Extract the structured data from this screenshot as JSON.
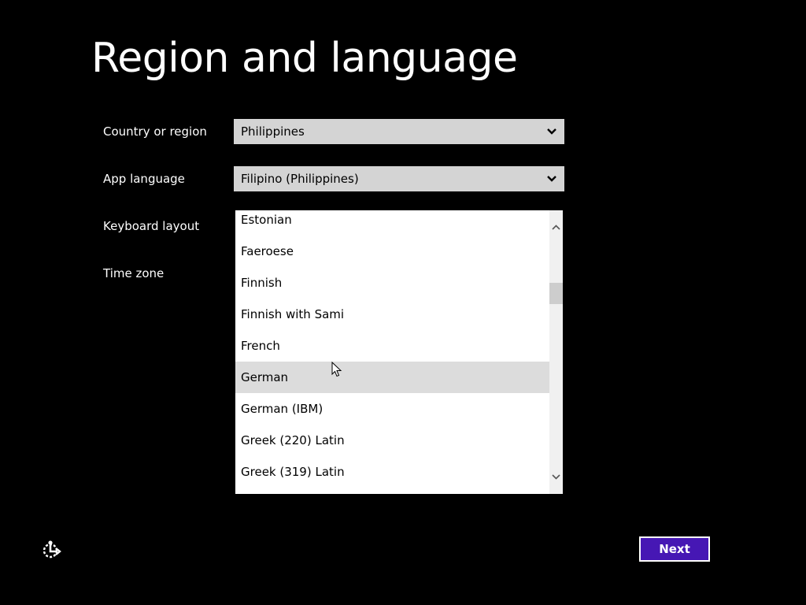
{
  "title": "Region and language",
  "labels": {
    "country": "Country or region",
    "app_language": "App language",
    "keyboard": "Keyboard layout",
    "time_zone": "Time zone"
  },
  "country": {
    "value": "Philippines"
  },
  "app_language": {
    "value": "Filipino (Philippines)"
  },
  "keyboard_list": {
    "items": [
      "Estonian",
      "Faeroese",
      "Finnish",
      "Finnish with Sami",
      "French",
      "German",
      "German (IBM)",
      "Greek (220) Latin",
      "Greek (319) Latin"
    ],
    "hovered_item": "German"
  },
  "buttons": {
    "next": "Next"
  },
  "icons": {
    "ease_of_access": "ease-of-access-icon",
    "dropdown": "chevron-down-icon",
    "scroll_up": "chevron-up-icon",
    "scroll_down": "chevron-down-icon",
    "cursor": "mouse-pointer-icon"
  },
  "colors": {
    "background": "#000000",
    "accent": "#4617b4",
    "select_background": "#d4d4d4",
    "hover_background": "#dcdcdc"
  }
}
